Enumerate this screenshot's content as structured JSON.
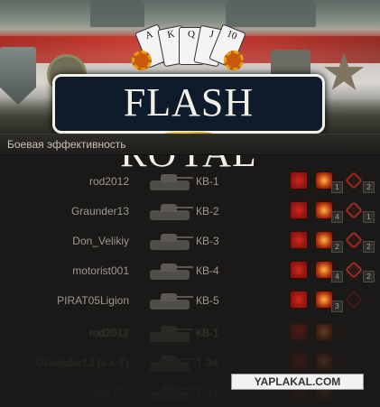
{
  "logo": {
    "text": "FLASH ROYAL",
    "cards": [
      "A",
      "K",
      "Q",
      "J",
      "10"
    ]
  },
  "section": {
    "title": "Боевая эффективность"
  },
  "rows": [
    {
      "player": "rod2012",
      "tank": "КВ-1",
      "hit_count": "1",
      "block_count": "2"
    },
    {
      "player": "Graunder13",
      "tank": "КВ-2",
      "hit_count": "4",
      "block_count": "1"
    },
    {
      "player": "Don_Velikiy",
      "tank": "КВ-3",
      "hit_count": "2",
      "block_count": "2"
    },
    {
      "player": "motorist001",
      "tank": "КВ-4",
      "hit_count": "4",
      "block_count": "2"
    },
    {
      "player": "PIRAT05Ligion",
      "tank": "КВ-5",
      "hit_count": "3",
      "block_count": ""
    }
  ],
  "dim_rows": [
    {
      "player": "rod2012",
      "tank": "КВ-1"
    },
    {
      "player": "Graunder13 (x-x-T)",
      "tank": "Т-34"
    },
    {
      "player": "Volto720",
      "tank": "Т-44"
    }
  ],
  "watermark": "YAPLAKAL.COM",
  "colors": {
    "background": "#1a1917",
    "text": "#9d988c",
    "logo_plate": "#0e1b2a",
    "damage_icon": "#d3271f",
    "hit_icon": "#ffb646"
  }
}
